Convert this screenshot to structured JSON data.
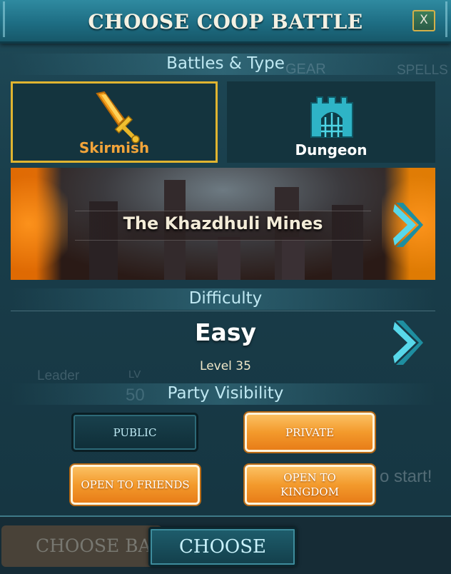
{
  "dialog": {
    "title": "CHOOSE COOP BATTLE",
    "close_label": "X"
  },
  "battles": {
    "section_label": "Battles & Type",
    "types": [
      {
        "label": "Skirmish",
        "selected": true,
        "icon": "sword-icon",
        "color": "#f2a43a"
      },
      {
        "label": "Dungeon",
        "selected": false,
        "icon": "castle-gate-icon",
        "color": "#ffffff"
      }
    ],
    "selected_battle": "The Khazdhuli Mines"
  },
  "difficulty": {
    "section_label": "Difficulty",
    "value": "Easy",
    "level": "Level 35"
  },
  "party_visibility": {
    "section_label": "Party Visibility",
    "options": [
      {
        "label": "PUBLIC",
        "selected": true
      },
      {
        "label": "PRIVATE",
        "selected": false
      },
      {
        "label": "OPEN TO FRIENDS",
        "selected": false
      },
      {
        "label": "OPEN TO KINGDOM",
        "selected": false
      }
    ]
  },
  "footer": {
    "choose_label": "CHOOSE",
    "background_button_label": "CHOOSE BATTLE"
  },
  "background": {
    "gear_label": "GEAR",
    "spells_label": "SPELLS",
    "leader_label": "Leader",
    "lv_label": "LV",
    "lv_value": "50",
    "start_text": "o start!"
  },
  "colors": {
    "selected_border": "#e0b430",
    "accent_cyan": "#4fd0e0",
    "orange_button": "#f39a2c"
  }
}
